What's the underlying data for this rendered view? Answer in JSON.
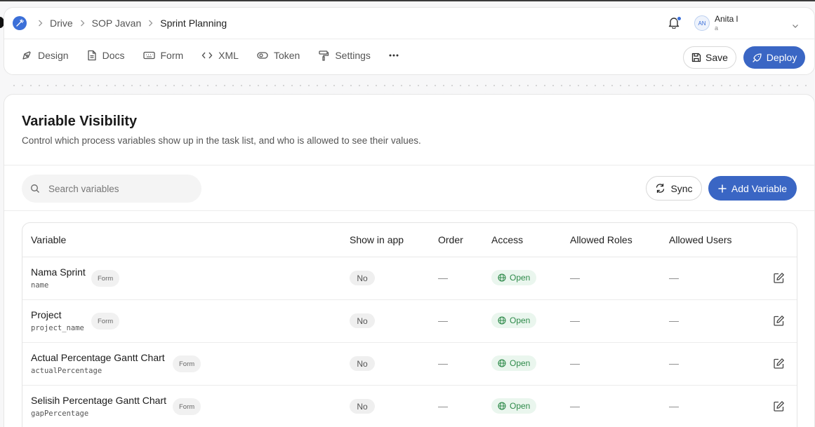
{
  "breadcrumb": {
    "items": [
      "Drive",
      "SOP Javan",
      "Sprint Planning"
    ]
  },
  "user": {
    "initials": "AN",
    "name": "Anita l",
    "sub": "a"
  },
  "nav": {
    "tabs": [
      "Design",
      "Docs",
      "Form",
      "XML",
      "Token",
      "Settings"
    ]
  },
  "actions": {
    "save_label": "Save",
    "deploy_label": "Deploy"
  },
  "page": {
    "title": "Variable Visibility",
    "description": "Control which process variables show up in the task list, and who is allowed to see their values."
  },
  "toolbar": {
    "search_placeholder": "Search variables",
    "sync_label": "Sync",
    "add_label": "Add Variable"
  },
  "table": {
    "headers": [
      "Variable",
      "Show in app",
      "Order",
      "Access",
      "Allowed Roles",
      "Allowed Users"
    ],
    "rows": [
      {
        "name": "Nama Sprint",
        "key": "name",
        "source": "Form",
        "show_in_app": "No",
        "order": "—",
        "access": "Open",
        "roles": "—",
        "users": "—"
      },
      {
        "name": "Project",
        "key": "project_name",
        "source": "Form",
        "show_in_app": "No",
        "order": "—",
        "access": "Open",
        "roles": "—",
        "users": "—"
      },
      {
        "name": "Actual Percentage Gantt Chart",
        "key": "actualPercentage",
        "source": "Form",
        "show_in_app": "No",
        "order": "—",
        "access": "Open",
        "roles": "—",
        "users": "—"
      },
      {
        "name": "Selisih Percentage Gantt Chart",
        "key": "gapPercentage",
        "source": "Form",
        "show_in_app": "No",
        "order": "—",
        "access": "Open",
        "roles": "—",
        "users": "—"
      }
    ]
  },
  "colors": {
    "accent": "#3a66c4",
    "open_green": "#2e8a4a",
    "open_bg": "#eaf6ee"
  }
}
